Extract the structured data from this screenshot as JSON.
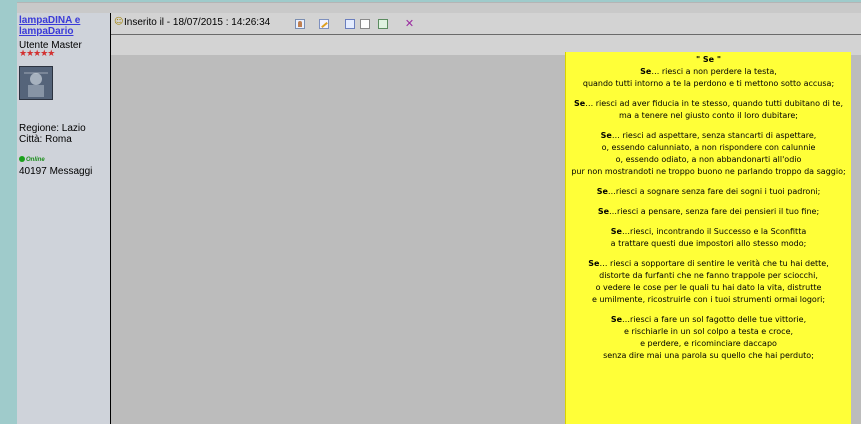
{
  "user": {
    "name": "lampaDINA e lampaDario",
    "rank": "Utente Master",
    "stars": "★★★★★",
    "region": "Regione: Lazio",
    "city": "Città: Roma",
    "online": "Online",
    "messages": "40197 Messaggi"
  },
  "post": {
    "smile": "☺",
    "inserted": "Inserito il - 18/07/2015 : 14:26:34",
    "toolbar": {
      "delete_glyph": "✕"
    }
  },
  "poem": {
    "title": "\" Se \"",
    "stanzas": [
      {
        "lead": "Se",
        "lines": [
          "… riesci a non perdere la testa,",
          "quando tutti intorno a te la perdono e ti mettono sotto accusa;"
        ]
      },
      {
        "lead": "Se",
        "lines": [
          "… riesci ad aver fiducia in te stesso, quando tutti dubitano di te,",
          "ma a tenere nel giusto conto il loro dubitare;"
        ]
      },
      {
        "lead": "Se",
        "lines": "… riesci ad aspettare, senza stancarti di aspettare,|o, essendo calunniato, a non rispondere con calunnie|o, essendo odiato, a non abbandonarti all'odio|pur non mostrandoti ne troppo buono ne parlando troppo da saggio;"
      },
      {
        "lead": "Se",
        "lines": [
          "…riesci a sognare senza fare dei sogni i tuoi padroni;"
        ]
      },
      {
        "lead": "Se",
        "lines": [
          "…riesci a pensare, senza fare dei pensieri il tuo fine;"
        ]
      },
      {
        "lead": "Se",
        "lines": [
          "…riesci, incontrando il Successo e la Sconfitta",
          "a trattare questi due impostori allo stesso modo;"
        ]
      },
      {
        "lead": "Se",
        "lines": [
          "… riesci a sopportare di sentire le verità che tu hai dette,",
          "distorte da furfanti che ne fanno trappole per sciocchi,",
          "o vedere le cose per le quali tu hai dato la vita, distrutte",
          "e umilmente, ricostruirle con i tuoi strumenti ormai logori;"
        ]
      },
      {
        "lead": "Se",
        "lines": [
          "…riesci a fare un sol fagotto delle tue vittorie,",
          "e rischiarle in un sol colpo a testa e croce,",
          "e perdere, e ricominciare daccapo",
          "senza dire mai una parola su quello che hai perduto;"
        ]
      }
    ]
  }
}
